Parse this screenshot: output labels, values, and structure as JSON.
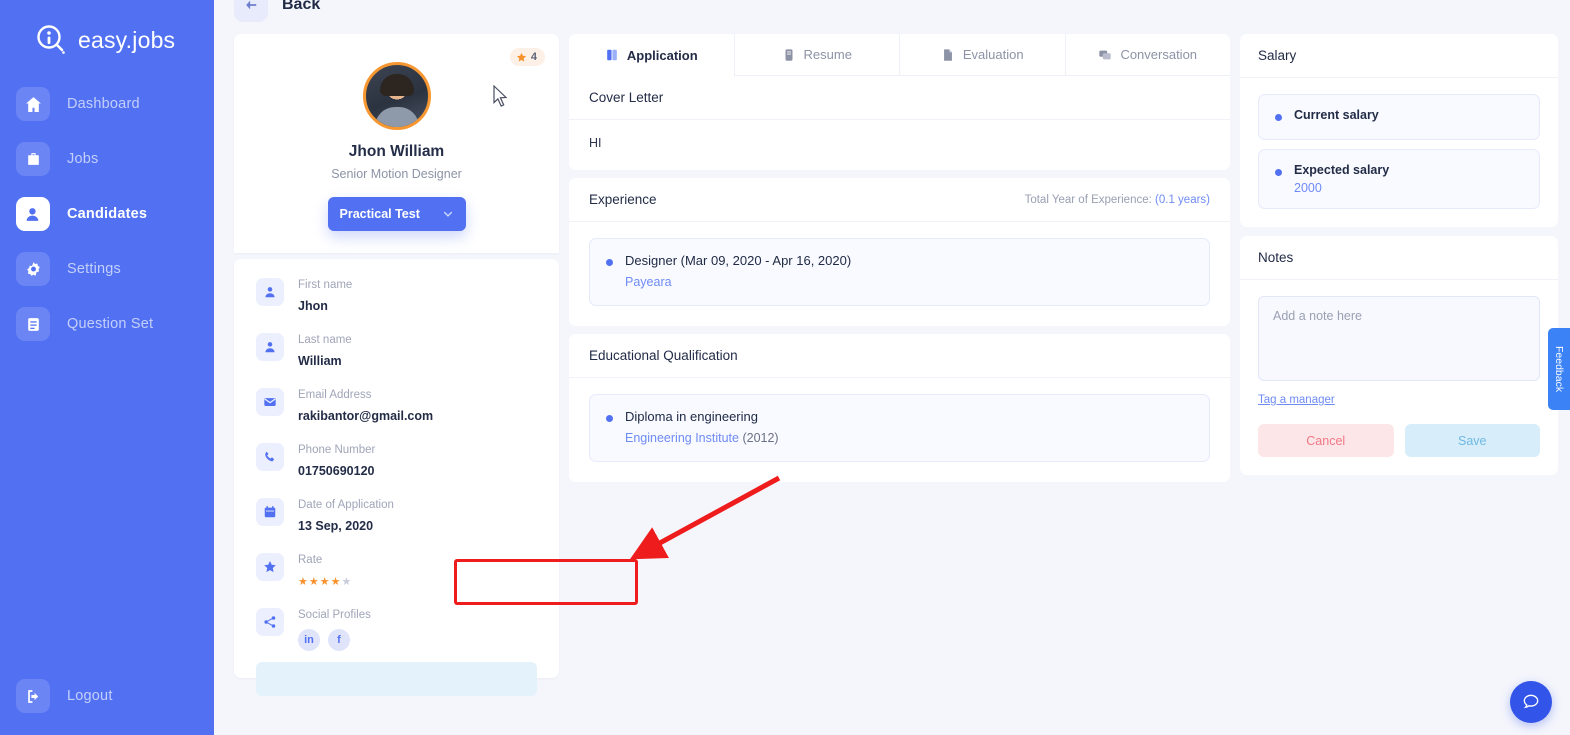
{
  "sidebar": {
    "brand": "easy.jobs",
    "items": [
      {
        "label": "Dashboard",
        "icon": "home-icon",
        "active": false
      },
      {
        "label": "Jobs",
        "icon": "briefcase-icon",
        "active": false
      },
      {
        "label": "Candidates",
        "icon": "user-icon",
        "active": true
      },
      {
        "label": "Settings",
        "icon": "gear-icon",
        "active": false
      },
      {
        "label": "Question Set",
        "icon": "clipboard-icon",
        "active": false
      }
    ],
    "logout_label": "Logout"
  },
  "topbar": {
    "back_label": "Back"
  },
  "profile": {
    "rating_badge": "4",
    "name": "Jhon William",
    "role": "Senior Motion Designer",
    "stage_button": "Practical Test"
  },
  "details": [
    {
      "label": "First name",
      "value": "Jhon",
      "icon": "user-icon"
    },
    {
      "label": "Last name",
      "value": "William",
      "icon": "user-icon"
    },
    {
      "label": "Email Address",
      "value": "rakibantor@gmail.com",
      "icon": "envelope-icon"
    },
    {
      "label": "Phone Number",
      "value": "01750690120",
      "icon": "phone-icon"
    },
    {
      "label": "Date of Application",
      "value": "13 Sep, 2020",
      "icon": "calendar-icon"
    },
    {
      "label": "Rate",
      "value": "",
      "icon": "star-icon",
      "stars_filled": 4,
      "stars_total": 5
    },
    {
      "label": "Social Profiles",
      "value": "",
      "icon": "share-icon",
      "socials": [
        "in",
        "f"
      ]
    }
  ],
  "tabs": [
    {
      "label": "Application",
      "icon": "application-icon",
      "active": true
    },
    {
      "label": "Resume",
      "icon": "resume-icon",
      "active": false
    },
    {
      "label": "Evaluation",
      "icon": "evaluation-icon",
      "active": false
    },
    {
      "label": "Conversation",
      "icon": "conversation-icon",
      "active": false
    }
  ],
  "cover_letter": {
    "title": "Cover Letter",
    "body": "HI"
  },
  "experience": {
    "title": "Experience",
    "total_label": "Total Year of Experience:",
    "total_value": "(0.1 years)",
    "items": [
      {
        "title": "Designer (Mar 09, 2020 - Apr 16, 2020)",
        "company": "Payeara"
      }
    ]
  },
  "education": {
    "title": "Educational Qualification",
    "items": [
      {
        "title": "Diploma in engineering",
        "institute": "Engineering Institute",
        "year": "(2012)"
      }
    ]
  },
  "salary": {
    "title": "Salary",
    "rows": [
      {
        "label": "Current salary",
        "value": ""
      },
      {
        "label": "Expected salary",
        "value": "2000"
      }
    ]
  },
  "notes": {
    "title": "Notes",
    "placeholder": "Add a note here",
    "value": "",
    "tag_link": "Tag a manager",
    "cancel_label": "Cancel",
    "save_label": "Save"
  },
  "overlays": {
    "feedback_label": "Feedback"
  },
  "colors": {
    "brand_blue": "#5271f2",
    "accent_orange": "#f7922f",
    "link_blue": "#6f8bf5",
    "annotation_red": "#ee1c1c",
    "page_bg": "#f5f6fc"
  }
}
